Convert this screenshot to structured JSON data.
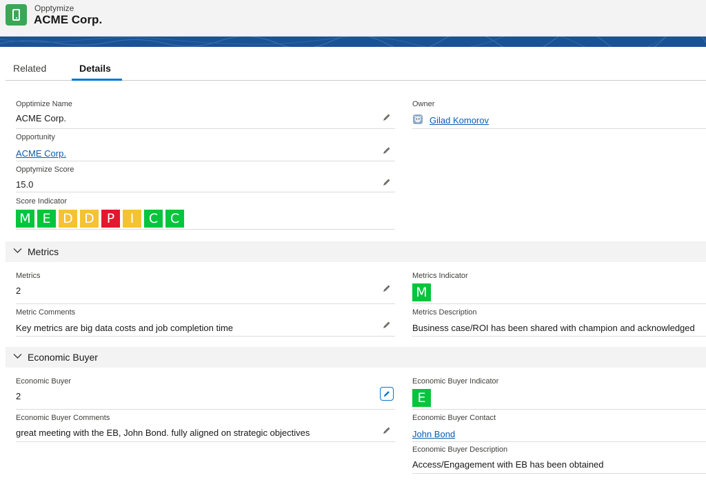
{
  "header": {
    "object_type": "Opptymize",
    "record_title": "ACME Corp.",
    "app_icon": "phone-icon",
    "app_icon_color": "#3ba755"
  },
  "tabs": [
    {
      "label": "Related",
      "active": false
    },
    {
      "label": "Details",
      "active": true
    }
  ],
  "colors": {
    "green": "#04c53b",
    "yellow": "#f5c233",
    "red": "#e3172e",
    "link": "#0b5cab",
    "accent": "#0176d3"
  },
  "details": {
    "name_label": "Opptimize Name",
    "name_value": "ACME Corp.",
    "opportunity_label": "Opportunity",
    "opportunity_value": "ACME Corp.",
    "score_label": "Opptymize Score",
    "score_value": "15.0",
    "indicator_label": "Score Indicator",
    "indicator_letters": [
      {
        "letter": "M",
        "color": "green"
      },
      {
        "letter": "E",
        "color": "green"
      },
      {
        "letter": "D",
        "color": "yellow"
      },
      {
        "letter": "D",
        "color": "yellow"
      },
      {
        "letter": "P",
        "color": "red"
      },
      {
        "letter": "I",
        "color": "yellow"
      },
      {
        "letter": "C",
        "color": "green"
      },
      {
        "letter": "C",
        "color": "green"
      }
    ],
    "owner_label": "Owner",
    "owner_value": "Gilad Komorov"
  },
  "metrics": {
    "section_title": "Metrics",
    "metrics_label": "Metrics",
    "metrics_value": "2",
    "comments_label": "Metric Comments",
    "comments_value": "Key metrics are big data costs and job completion time",
    "indicator_label": "Metrics Indicator",
    "indicator_letter": "M",
    "description_label": "Metrics Description",
    "description_value": "Business case/ROI has been shared with champion and acknowledged"
  },
  "economic_buyer": {
    "section_title": "Economic Buyer",
    "eb_label": "Economic Buyer",
    "eb_value": "2",
    "comments_label": "Economic Buyer Comments",
    "comments_value": "great meeting with the EB, John Bond. fully aligned on strategic objectives",
    "indicator_label": "Economic Buyer Indicator",
    "indicator_letter": "E",
    "contact_label": "Economic Buyer Contact",
    "contact_value": "John Bond",
    "description_label": "Economic Buyer Description",
    "description_value": "Access/Engagement with EB has been obtained"
  }
}
